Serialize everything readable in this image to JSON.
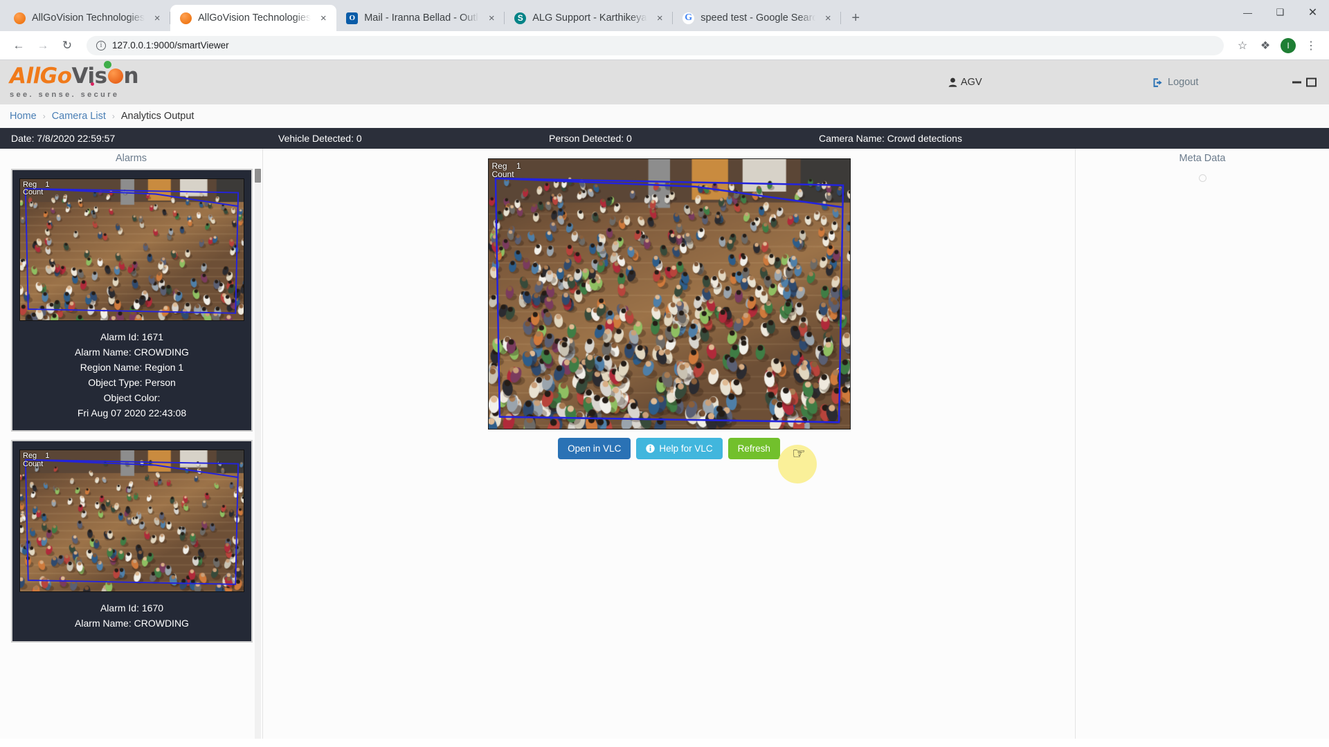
{
  "browser": {
    "tabs": [
      {
        "title": "AllGoVision Technologies",
        "favicon": "agv-orb-icon",
        "active": false
      },
      {
        "title": "AllGoVision Technologies",
        "favicon": "agv-orb-icon",
        "active": true
      },
      {
        "title": "Mail - Iranna Bellad - Outlook",
        "favicon": "outlook-icon",
        "active": false
      },
      {
        "title": "ALG Support - Karthikeyan - All D",
        "favicon": "sharepoint-icon",
        "active": false
      },
      {
        "title": "speed test - Google Search",
        "favicon": "google-icon",
        "active": false
      }
    ],
    "new_tab_label": "+",
    "close_glyph": "×",
    "window_controls": {
      "minimize": "—",
      "maximize": "❑",
      "close": "✕"
    },
    "nav": {
      "back": "←",
      "forward": "→",
      "reload": "↻"
    },
    "url": "127.0.0.1:9000/smartViewer",
    "url_info_glyph": "i",
    "toolbar_icons": {
      "bookmark": "☆",
      "extensions": "❖",
      "profile_initial": "I",
      "menu": "⋮"
    }
  },
  "app": {
    "logo": {
      "part1": "AllGo",
      "part2": "Vis",
      "part3": "n",
      "tagline": "see. sense. secure"
    },
    "user": {
      "name": "AGV",
      "icon": "user-icon"
    },
    "logout": {
      "label": "Logout",
      "icon": "logout-icon"
    },
    "window_controls": {
      "minimize": "minimize-icon",
      "maximize": "maximize-icon"
    }
  },
  "breadcrumb": {
    "items": [
      "Home",
      "Camera List",
      "Analytics Output"
    ],
    "separator": "›"
  },
  "status": {
    "date": "Date: 7/8/2020 22:59:57",
    "vehicle": "Vehicle Detected: 0",
    "person": "Person Detected: 0",
    "camera": "Camera Name: Crowd detections"
  },
  "alarms_panel": {
    "title": "Alarms",
    "overlay_label": "Reg    1\nCount",
    "cards": [
      {
        "alarm_id": "Alarm Id: 1671",
        "alarm_name": "Alarm Name: CROWDING",
        "region_name": "Region Name: Region 1",
        "object_type": "Object Type: Person",
        "object_color": "Object Color:",
        "timestamp": "Fri Aug 07 2020 22:43:08"
      },
      {
        "alarm_id": "Alarm Id: 1670",
        "alarm_name": "Alarm Name: CROWDING",
        "region_name": "",
        "object_type": "",
        "object_color": "",
        "timestamp": ""
      }
    ]
  },
  "video_panel": {
    "overlay_label": "Reg    1\nCount",
    "buttons": {
      "open_vlc": "Open in VLC",
      "help_vlc": "Help for VLC",
      "help_icon": "info-icon",
      "refresh": "Refresh"
    }
  },
  "meta_panel": {
    "title": "Meta Data",
    "spinner": "loading-spinner-icon"
  },
  "colors": {
    "status_bar": "#2b2f3a",
    "card_bg": "#242936",
    "btn_vlc": "#2a72b5",
    "btn_help": "#41b6dd",
    "btn_refresh": "#72c02c",
    "region_line": "#2323dd",
    "logo_orange": "#f07a1a",
    "link_blue": "#4a7fb5"
  }
}
